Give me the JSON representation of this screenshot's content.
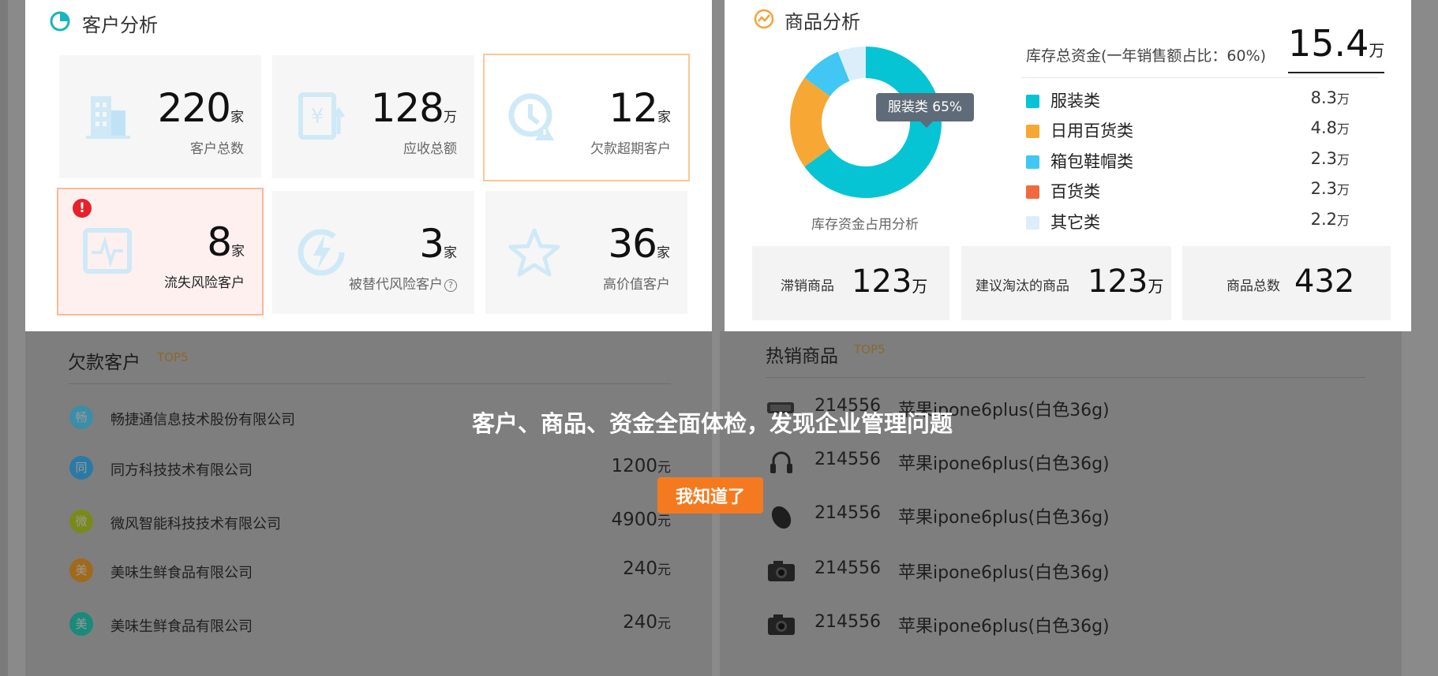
{
  "customer_panel": {
    "title": "客户分析",
    "cards": [
      {
        "value": "220",
        "unit": "家",
        "label": "客户总数",
        "icon": "building-icon"
      },
      {
        "value": "128",
        "unit": "万",
        "label": "应收总额",
        "icon": "yen-document-icon"
      },
      {
        "value": "12",
        "unit": "家",
        "label": "欠款超期客户",
        "icon": "clock-warning-icon"
      },
      {
        "value": "8",
        "unit": "家",
        "label": "流失风险客户",
        "icon": "pulse-icon",
        "badge": "!"
      },
      {
        "value": "3",
        "unit": "家",
        "label": "被替代风险客户",
        "icon": "lightning-icon",
        "help": "?"
      },
      {
        "value": "36",
        "unit": "家",
        "label": "高价值客户",
        "icon": "star-icon"
      }
    ]
  },
  "goods_panel": {
    "title": "商品分析",
    "inventory_label": "库存总资金(一年销售额占比：60%)",
    "inventory_value": "15.4",
    "inventory_unit": "万",
    "donut_caption": "库存资金占用分析",
    "tooltip": "服装类  65%",
    "boxes": [
      {
        "label": "滞销商品",
        "value": "123",
        "unit": "万"
      },
      {
        "label": "建议淘汰的商品",
        "value": "123",
        "unit": "万"
      },
      {
        "label": "商品总数",
        "value": "432",
        "unit": ""
      }
    ]
  },
  "chart_data": {
    "type": "pie",
    "categories": [
      "服装类",
      "日用百货类",
      "箱包鞋帽类",
      "百货类",
      "其它类"
    ],
    "values": [
      8.3,
      4.8,
      2.3,
      2.3,
      2.2
    ],
    "value_labels": [
      "8.3",
      "4.8",
      "2.3",
      "2.3",
      "2.2"
    ],
    "unit": "万",
    "colors": [
      "#06c4d4",
      "#f7a733",
      "#40c7f4",
      "#f06a40",
      "#dbeef9"
    ],
    "donut_slices_percent": [
      65,
      20,
      9,
      0,
      6
    ],
    "donut_slice_colors": [
      "#06c4d4",
      "#f7a733",
      "#40c7f4",
      "#f06a40",
      "#dbeef9"
    ]
  },
  "debt_section": {
    "title": "欠款客户",
    "tag": "TOP5",
    "rows": [
      {
        "avatar": "畅",
        "name": "畅捷通信息技术股份有限公司",
        "amount": "",
        "unit": "",
        "color": "#3a8ea8"
      },
      {
        "avatar": "同",
        "name": "同方科技技术有限公司",
        "amount": "1200",
        "unit": "元",
        "color": "#2a7aa6"
      },
      {
        "avatar": "微",
        "name": "微风智能科技技术有限公司",
        "amount": "4900",
        "unit": "元",
        "color": "#7a8a1a"
      },
      {
        "avatar": "美",
        "name": "美味生鲜食品有限公司",
        "amount": "240",
        "unit": "元",
        "color": "#a06a1a"
      },
      {
        "avatar": "美",
        "name": "美味生鲜食品有限公司",
        "amount": "240",
        "unit": "元",
        "color": "#1a8a7a"
      }
    ]
  },
  "hot_section": {
    "title": "热销商品",
    "tag": "TOP5",
    "rows": [
      {
        "id": "214556",
        "name": "苹果ipone6plus(白色36g)",
        "icon": "tablet-icon"
      },
      {
        "id": "214556",
        "name": "苹果ipone6plus(白色36g)",
        "icon": "headphones-icon"
      },
      {
        "id": "214556",
        "name": "苹果ipone6plus(白色36g)",
        "icon": "mouse-icon"
      },
      {
        "id": "214556",
        "name": "苹果ipone6plus(白色36g)",
        "icon": "camera-icon"
      },
      {
        "id": "214556",
        "name": "苹果ipone6plus(白色36g)",
        "icon": "camera-icon"
      }
    ]
  },
  "guide": {
    "text": "客户、商品、资金全面体检，发现企业管理问题",
    "button": "我知道了"
  }
}
